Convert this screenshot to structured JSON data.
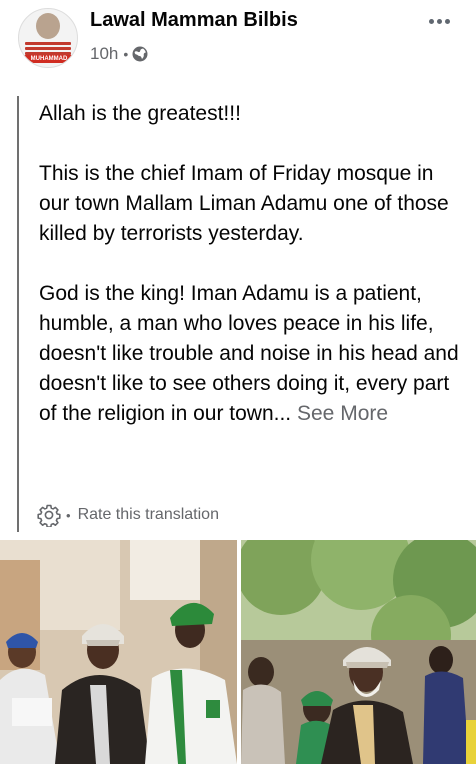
{
  "post": {
    "author": "Lawal Mamman Bilbis",
    "time": "10h",
    "meta_separator": "•",
    "privacy_icon": "globe-icon",
    "more_icon": "more-options-icon",
    "avatar_caption": "MUHAMMAD",
    "body": {
      "paragraphs": [
        "Allah is the greatest!!!",
        "This is the chief Imam of Friday mosque in our town Mallam Liman Adamu one of those killed by terrorists yesterday.",
        "God is the king! Iman Adamu is a patient, humble, a man who loves peace in his life, doesn't like trouble and noise in his head and doesn't like to see others doing it, every part of the religion in our town..."
      ],
      "see_more": "See More"
    },
    "translation": {
      "icon": "gear-icon",
      "separator": "•",
      "label": "Rate this translation"
    },
    "photos": [
      {
        "name": "photo-men-in-caps"
      },
      {
        "name": "photo-imam-outdoors"
      }
    ]
  }
}
